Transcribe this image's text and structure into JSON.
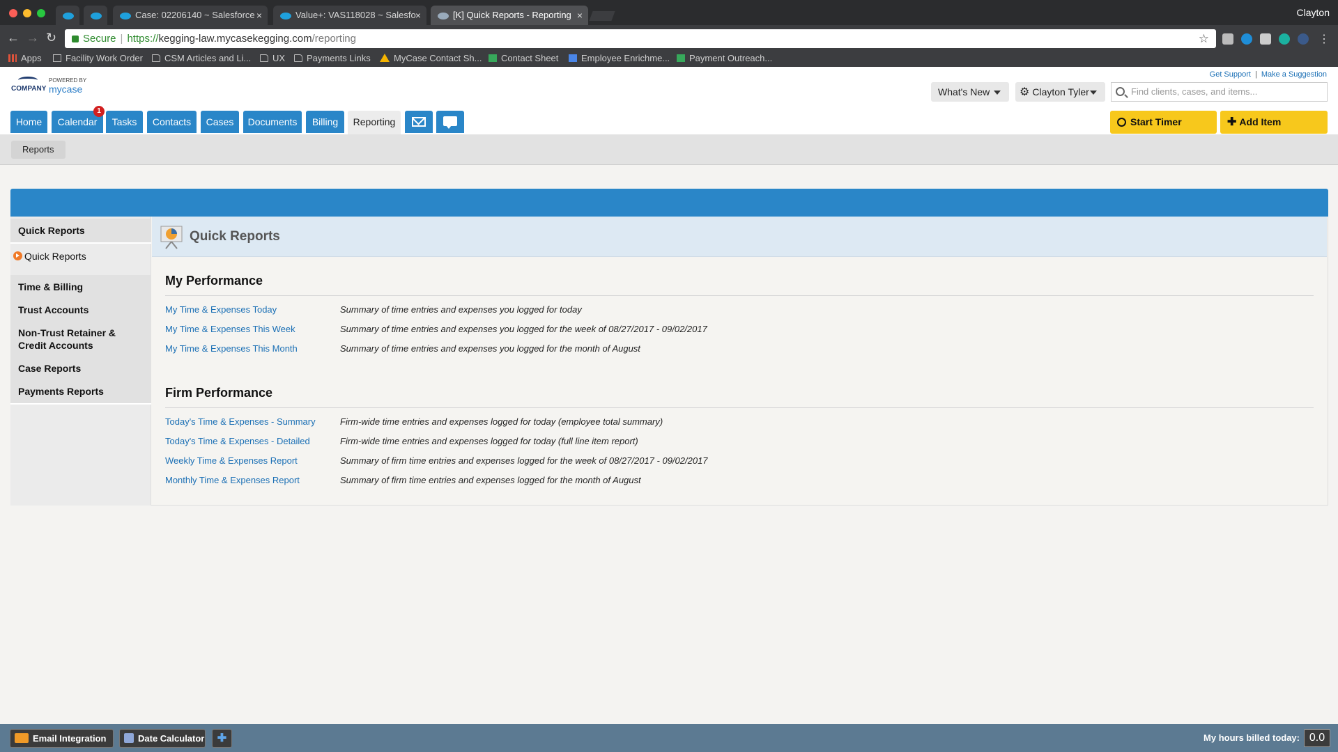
{
  "browser": {
    "tabs": [
      {
        "title": ""
      },
      {
        "title": ""
      },
      {
        "title": "Case: 02206140 ~ Salesforce"
      },
      {
        "title": "Value+: VAS118028 ~ Salesfo"
      },
      {
        "title": "[K] Quick Reports - Reporting"
      }
    ],
    "profile": "Clayton",
    "secure_label": "Secure",
    "url_scheme": "https://",
    "url_host": "kegging-law.mycasekegging.com",
    "url_path": "/reporting",
    "bookmarks": [
      {
        "label": "Apps",
        "icon": "apps-icon"
      },
      {
        "label": "Facility Work Order",
        "icon": "page-icon"
      },
      {
        "label": "CSM Articles and Li...",
        "icon": "folder-icon"
      },
      {
        "label": "UX",
        "icon": "folder-icon"
      },
      {
        "label": "Payments Links",
        "icon": "folder-icon"
      },
      {
        "label": "MyCase Contact Sh...",
        "icon": "drive-icon"
      },
      {
        "label": "Contact Sheet",
        "icon": "sheet-icon"
      },
      {
        "label": "Employee Enrichme...",
        "icon": "doc-icon"
      },
      {
        "label": "Payment Outreach...",
        "icon": "sheet-icon"
      }
    ]
  },
  "header": {
    "logo_text": "COMPANY",
    "powered_by": "POWERED BY",
    "brand": "mycase",
    "get_support": "Get Support",
    "divider": "|",
    "make_suggestion": "Make a Suggestion",
    "whats_new": "What's New",
    "user": "Clayton Tyler",
    "search_placeholder": "Find clients, cases, and items..."
  },
  "nav": {
    "tabs": [
      "Home",
      "Calendar",
      "Tasks",
      "Contacts",
      "Cases",
      "Documents",
      "Billing",
      "Reporting"
    ],
    "active": "Reporting",
    "calendar_badge": "1",
    "start_timer": "Start Timer",
    "add_item": "Add Item",
    "accent_color": "#2a86c8",
    "button_color": "#f7c81c"
  },
  "subnav": {
    "reports": "Reports"
  },
  "sidebar": {
    "quick_reports_heading": "Quick Reports",
    "quick_reports_link": "Quick Reports",
    "items": [
      "Time & Billing",
      "Trust Accounts",
      "Non-Trust Retainer & Credit Accounts",
      "Case Reports",
      "Payments Reports"
    ]
  },
  "main": {
    "title": "Quick Reports",
    "my_performance": {
      "heading": "My Performance",
      "rows": [
        {
          "link": "My Time & Expenses Today",
          "desc": "Summary of time entries and expenses you logged for today"
        },
        {
          "link": "My Time & Expenses This Week",
          "desc": "Summary of time entries and expenses you logged for the week of 08/27/2017 - 09/02/2017"
        },
        {
          "link": "My Time & Expenses This Month",
          "desc": "Summary of time entries and expenses you logged for the month of August"
        }
      ]
    },
    "firm_performance": {
      "heading": "Firm Performance",
      "rows": [
        {
          "link": "Today's Time & Expenses - Summary",
          "desc": "Firm-wide time entries and expenses logged for today (employee total summary)"
        },
        {
          "link": "Today's Time & Expenses - Detailed",
          "desc": "Firm-wide time entries and expenses logged for today (full line item report)"
        },
        {
          "link": "Weekly Time & Expenses Report",
          "desc": "Summary of firm time entries and expenses logged for the week of 08/27/2017 - 09/02/2017"
        },
        {
          "link": "Monthly Time & Expenses Report",
          "desc": "Summary of firm time entries and expenses logged for the month of August"
        }
      ]
    }
  },
  "footer": {
    "email_integration": "Email Integration",
    "date_calculator": "Date Calculator",
    "hours_label": "My hours billed today:",
    "hours_value": "0.0"
  }
}
